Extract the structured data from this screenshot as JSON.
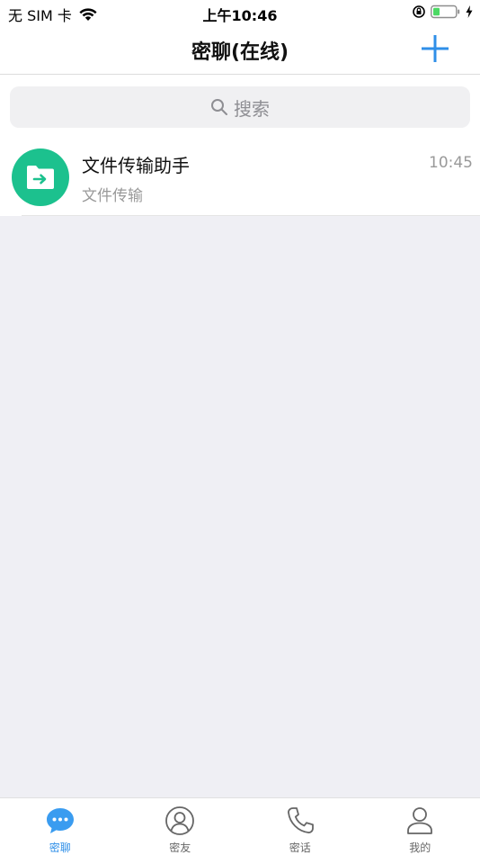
{
  "status_bar": {
    "carrier": "无 SIM 卡",
    "time": "上午10:46"
  },
  "nav": {
    "title": "密聊(在线)",
    "add_icon": "plus-icon"
  },
  "search": {
    "placeholder": "搜索",
    "icon": "search-icon"
  },
  "chats": [
    {
      "name": "文件传输助手",
      "preview": "文件传输",
      "time": "10:45",
      "icon": "folder-transfer-icon"
    }
  ],
  "tabs": [
    {
      "label": "密聊",
      "icon": "chat-bubble-icon",
      "active": true
    },
    {
      "label": "密友",
      "icon": "contact-icon",
      "active": false
    },
    {
      "label": "密话",
      "icon": "phone-icon",
      "active": false
    },
    {
      "label": "我的",
      "icon": "user-icon",
      "active": false
    }
  ],
  "colors": {
    "accent": "#2f8fe8",
    "avatar": "#1cc18e",
    "background": "#efeff4"
  }
}
